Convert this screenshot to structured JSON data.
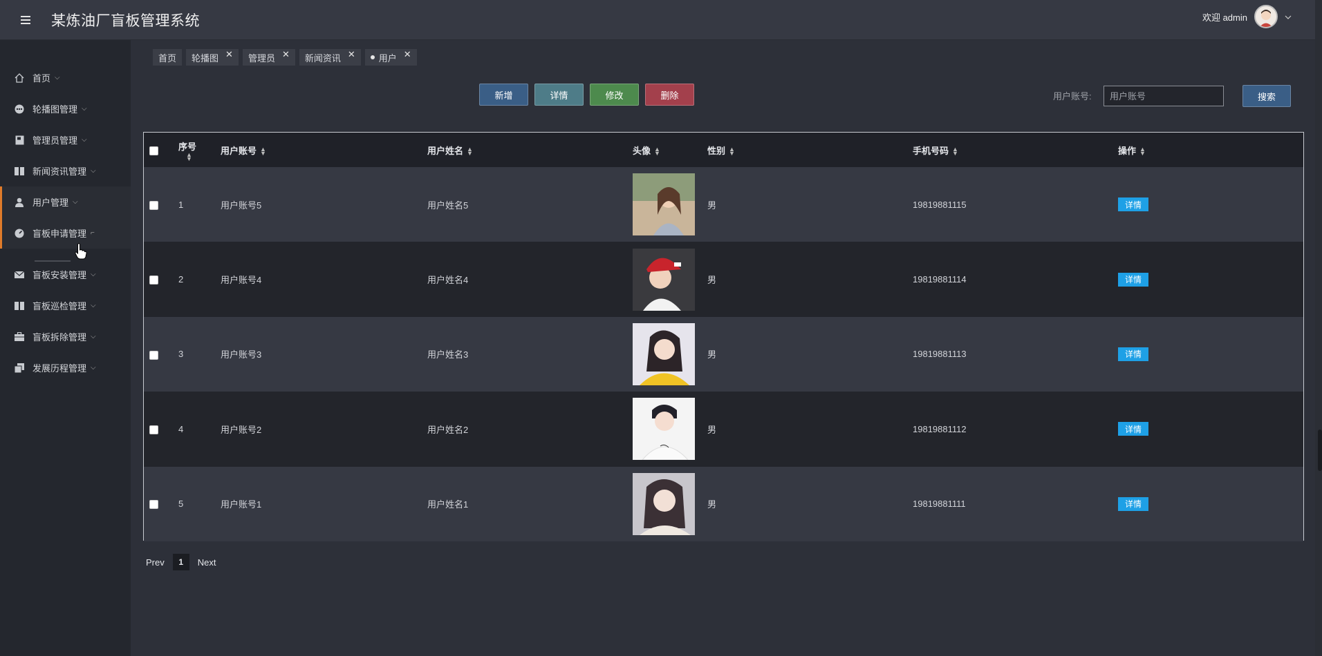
{
  "header": {
    "title": "某炼油厂盲板管理系统",
    "welcome": "欢迎 admin"
  },
  "sidebar": {
    "items": [
      {
        "label": "首页",
        "icon": "home-icon"
      },
      {
        "label": "轮播图管理",
        "icon": "carousel-icon"
      },
      {
        "label": "管理员管理",
        "icon": "book-icon"
      },
      {
        "label": "新闻资讯管理",
        "icon": "news-icon"
      },
      {
        "label": "用户管理",
        "icon": "user-icon"
      },
      {
        "label": "盲板申请管理",
        "icon": "gauge-icon"
      },
      {
        "label": "盲板安装管理",
        "icon": "mail-icon"
      },
      {
        "label": "盲板巡检管理",
        "icon": "columns-icon"
      },
      {
        "label": "盲板拆除管理",
        "icon": "briefcase-icon"
      },
      {
        "label": "发展历程管理",
        "icon": "copy-icon"
      }
    ]
  },
  "tags": [
    {
      "label": "首页",
      "closable": false
    },
    {
      "label": "轮播图",
      "closable": true
    },
    {
      "label": "管理员",
      "closable": true
    },
    {
      "label": "新闻资讯",
      "closable": true
    },
    {
      "label": "用户",
      "closable": true,
      "active": true
    }
  ],
  "actions": {
    "add": "新增",
    "detail": "详情",
    "edit": "修改",
    "delete": "删除"
  },
  "search": {
    "label": "用户账号:",
    "placeholder": "用户账号",
    "button": "搜索"
  },
  "table": {
    "headers": {
      "seq": "序号",
      "account": "用户账号",
      "name": "用户姓名",
      "avatar": "头像",
      "gender": "性别",
      "phone": "手机号码",
      "ops": "操作"
    },
    "rows": [
      {
        "seq": "1",
        "account": "用户账号5",
        "name": "用户姓名5",
        "gender": "男",
        "phone": "19819881115",
        "op": "详情"
      },
      {
        "seq": "2",
        "account": "用户账号4",
        "name": "用户姓名4",
        "gender": "男",
        "phone": "19819881114",
        "op": "详情"
      },
      {
        "seq": "3",
        "account": "用户账号3",
        "name": "用户姓名3",
        "gender": "男",
        "phone": "19819881113",
        "op": "详情"
      },
      {
        "seq": "4",
        "account": "用户账号2",
        "name": "用户姓名2",
        "gender": "男",
        "phone": "19819881112",
        "op": "详情"
      },
      {
        "seq": "5",
        "account": "用户账号1",
        "name": "用户姓名1",
        "gender": "男",
        "phone": "19819881111",
        "op": "详情"
      }
    ]
  },
  "pagination": {
    "prev": "Prev",
    "current": "1",
    "next": "Next"
  },
  "colors": {
    "accent": "#e07b2a",
    "detail_button": "#1ea0e6",
    "add_button": "#3a5e86",
    "edit_button": "#4d8a4d",
    "delete_button": "#a3404c"
  }
}
